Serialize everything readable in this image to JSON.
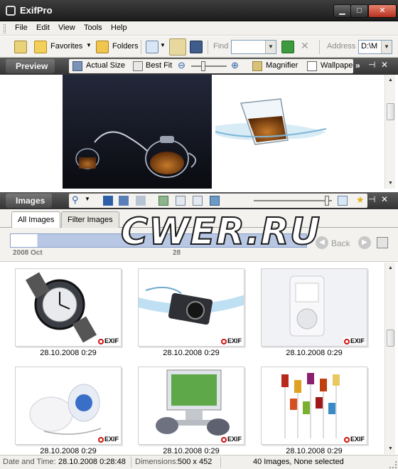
{
  "window": {
    "title": "ExifPro"
  },
  "menu": [
    "File",
    "Edit",
    "View",
    "Tools",
    "Help"
  ],
  "toolbar": {
    "favorites_label": "Favorites",
    "folders_label": "Folders",
    "find_label": "Find",
    "find_value": "",
    "address_label": "Address",
    "address_value": "D:\\M"
  },
  "preview_bar": {
    "title": "Preview",
    "actual_size": "Actual Size",
    "best_fit": "Best Fit",
    "magnifier": "Magnifier",
    "wallpaper": "Wallpape"
  },
  "images_bar": {
    "title": "Images"
  },
  "tabs": [
    "All Images",
    "Filter Images"
  ],
  "timeline": {
    "label": "2008 Oct",
    "label2": "28",
    "back_label": "Back"
  },
  "watermark_text": "CWER.RU",
  "thumbnails": [
    {
      "caption": "28.10.2008  0:29",
      "badge": "EXIF",
      "icon": "watch-photo"
    },
    {
      "caption": "28.10.2008  0:29",
      "badge": "EXIF",
      "icon": "camera-splash-photo"
    },
    {
      "caption": "28.10.2008  0:29",
      "badge": "EXIF",
      "icon": "ipod-photo"
    },
    {
      "caption": "28.10.2008  0:29",
      "badge": "EXIF",
      "icon": "egg-speaker-photo"
    },
    {
      "caption": "28.10.2008  0:29",
      "badge": "EXIF",
      "icon": "monitor-pigeons-photo"
    },
    {
      "caption": "28.10.2008  0:29",
      "badge": "EXIF",
      "icon": "glasses-photo"
    }
  ],
  "status": {
    "datetime_label": "Date and Time:",
    "datetime_value": "28.10.2008  0:28:48",
    "dimensions_label": "Dimensions:",
    "dimensions_value": "500 x 452",
    "summary": "40 Images, None selected"
  }
}
